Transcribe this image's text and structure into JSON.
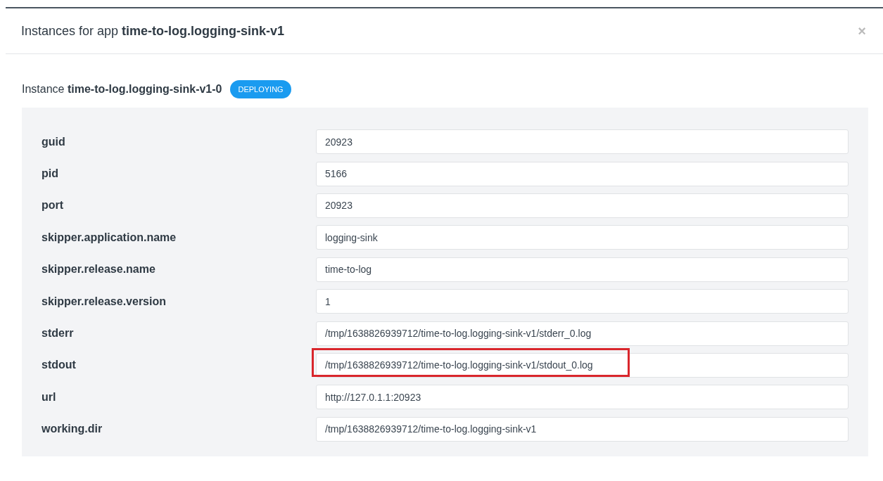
{
  "modal": {
    "title_prefix": "Instances for app",
    "title_app": "time-to-log.logging-sink-v1",
    "close": "×"
  },
  "instance": {
    "prefix": "Instance",
    "name": "time-to-log.logging-sink-v1-0",
    "status": "DEPLOYING"
  },
  "properties": [
    {
      "label": "guid",
      "value": "20923",
      "highlighted": false
    },
    {
      "label": "pid",
      "value": "5166",
      "highlighted": false
    },
    {
      "label": "port",
      "value": "20923",
      "highlighted": false
    },
    {
      "label": "skipper.application.name",
      "value": "logging-sink",
      "highlighted": false
    },
    {
      "label": "skipper.release.name",
      "value": "time-to-log",
      "highlighted": false
    },
    {
      "label": "skipper.release.version",
      "value": "1",
      "highlighted": false
    },
    {
      "label": "stderr",
      "value": "/tmp/1638826939712/time-to-log.logging-sink-v1/stderr_0.log",
      "highlighted": false
    },
    {
      "label": "stdout",
      "value": "/tmp/1638826939712/time-to-log.logging-sink-v1/stdout_0.log",
      "highlighted": true
    },
    {
      "label": "url",
      "value": "http://127.0.1.1:20923",
      "highlighted": false
    },
    {
      "label": "working.dir",
      "value": "/tmp/1638826939712/time-to-log.logging-sink-v1",
      "highlighted": false
    }
  ]
}
